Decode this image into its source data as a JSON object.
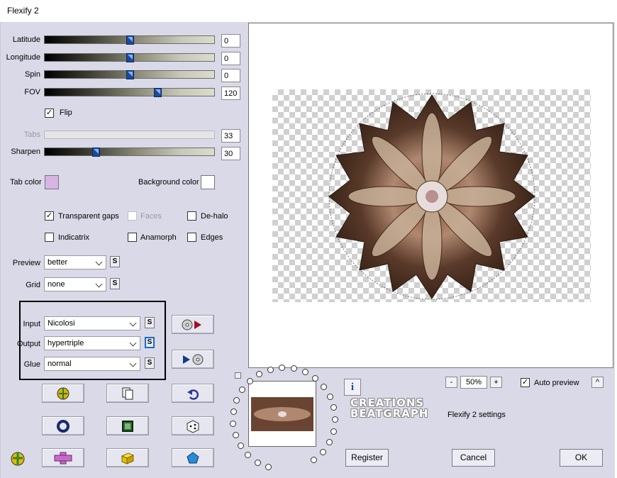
{
  "window": {
    "title": "Flexify 2"
  },
  "sliders": [
    {
      "label": "Latitude",
      "value": "0",
      "level": 0.5,
      "disabled": false
    },
    {
      "label": "Longitude",
      "value": "0",
      "level": 0.5,
      "disabled": false
    },
    {
      "label": "Spin",
      "value": "0",
      "level": 0.5,
      "disabled": false
    },
    {
      "label": "FOV",
      "value": "120",
      "level": 0.667,
      "disabled": false
    },
    {
      "label": "Tabs",
      "value": "33",
      "level": 0.33,
      "disabled": true
    },
    {
      "label": "Sharpen",
      "value": "30",
      "level": 0.3,
      "disabled": false
    }
  ],
  "flip": {
    "label": "Flip",
    "checked": true
  },
  "tab_color": {
    "label": "Tab color",
    "color": "#d8b4e2"
  },
  "background_color": {
    "label": "Background color",
    "color": "#ffffff"
  },
  "options": {
    "transparent_gaps": {
      "label": "Transparent gaps",
      "checked": true
    },
    "faces": {
      "label": "Faces",
      "checked": false,
      "disabled": true
    },
    "de_halo": {
      "label": "De-halo",
      "checked": false
    },
    "indicatrix": {
      "label": "Indicatrix",
      "checked": false
    },
    "anamorph": {
      "label": "Anamorph",
      "checked": false
    },
    "edges": {
      "label": "Edges",
      "checked": false
    }
  },
  "preview_select": {
    "label": "Preview",
    "value": "better"
  },
  "grid_select": {
    "label": "Grid",
    "value": "none"
  },
  "input_select": {
    "label": "Input",
    "value": "Nicolosi"
  },
  "output_select": {
    "label": "Output",
    "value": "hypertriple"
  },
  "glue_select": {
    "label": "Glue",
    "value": "normal"
  },
  "s_label": "S",
  "zoom": {
    "value": "50%",
    "minus": "-",
    "plus": "+"
  },
  "auto_preview": {
    "label": "Auto preview",
    "checked": true
  },
  "caret": "^",
  "watermark": [
    "CREATIONS",
    "BEATGRAPH"
  ],
  "settings_label": "Flexify 2 settings",
  "buttons": {
    "register": "Register",
    "cancel": "Cancel",
    "ok": "OK"
  },
  "info_label": "i",
  "colors": {
    "dialog_bg": "#d9d9e8",
    "thumb": "#1d4a96",
    "accent": "#1a6cc8"
  }
}
